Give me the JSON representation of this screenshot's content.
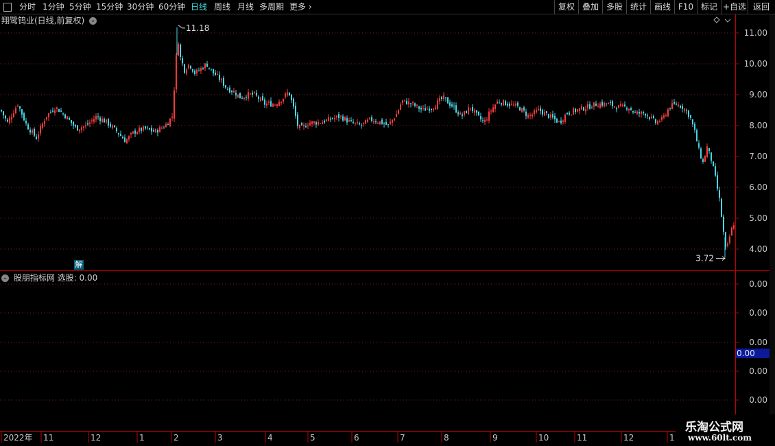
{
  "toolbar": {
    "periods": [
      "分时",
      "1分钟",
      "5分钟",
      "15分钟",
      "30分钟",
      "60分钟",
      "日线",
      "周线",
      "月线",
      "多周期",
      "更多"
    ],
    "active_period": "日线",
    "right_buttons": [
      "复权",
      "叠加",
      "多股",
      "统计",
      "画线",
      "F10",
      "标记",
      "+自选",
      "返回"
    ]
  },
  "stock_title": "翔鹭钨业(日线,前复权)",
  "indicator_title": "股朋指标网 选股: 0.00",
  "jie_label": "解",
  "annotations": {
    "high": "11.18",
    "low": "3.72"
  },
  "chart_data": {
    "type": "candlestick",
    "title": "翔鹭钨业(日线,前复权)",
    "price_ticks": [
      "11.00",
      "10.00",
      "9.00",
      "8.00",
      "7.00",
      "6.00",
      "5.00",
      "4.00"
    ],
    "price_range": [
      3.5,
      11.5
    ],
    "high": 11.18,
    "low": 3.72,
    "indicator": {
      "name": "选股",
      "value": 0.0,
      "ticks": [
        "0.00",
        "0.00",
        "0.00",
        "0.00",
        "0.00"
      ],
      "current_label": "0.00"
    },
    "x_labels": [
      "2022年",
      "11",
      "12",
      "1",
      "2",
      "3",
      "4",
      "5",
      "6",
      "7",
      "8",
      "9",
      "10",
      "11",
      "12",
      "1"
    ],
    "close_path": [
      [
        0,
        8.5
      ],
      [
        10,
        8.1
      ],
      [
        25,
        8.7
      ],
      [
        38,
        8.0
      ],
      [
        52,
        7.6
      ],
      [
        66,
        8.3
      ],
      [
        80,
        8.6
      ],
      [
        95,
        8.3
      ],
      [
        110,
        7.9
      ],
      [
        125,
        8.0
      ],
      [
        140,
        8.3
      ],
      [
        155,
        8.1
      ],
      [
        170,
        7.8
      ],
      [
        182,
        7.5
      ],
      [
        195,
        7.8
      ],
      [
        210,
        7.9
      ],
      [
        225,
        7.8
      ],
      [
        240,
        8.0
      ],
      [
        250,
        8.3
      ],
      [
        253,
        9.2
      ],
      [
        258,
        10.9
      ],
      [
        262,
        10.2
      ],
      [
        268,
        9.8
      ],
      [
        275,
        10.0
      ],
      [
        283,
        9.7
      ],
      [
        290,
        9.8
      ],
      [
        300,
        10.0
      ],
      [
        310,
        9.7
      ],
      [
        320,
        9.5
      ],
      [
        330,
        9.2
      ],
      [
        340,
        9.1
      ],
      [
        350,
        8.9
      ],
      [
        360,
        9.0
      ],
      [
        370,
        9.0
      ],
      [
        385,
        8.7
      ],
      [
        400,
        8.7
      ],
      [
        412,
        8.9
      ],
      [
        420,
        9.1
      ],
      [
        428,
        8.5
      ],
      [
        433,
        8.0
      ],
      [
        438,
        7.9
      ],
      [
        450,
        8.1
      ],
      [
        465,
        8.1
      ],
      [
        480,
        8.2
      ],
      [
        495,
        8.3
      ],
      [
        510,
        8.1
      ],
      [
        525,
        8.0
      ],
      [
        540,
        8.2
      ],
      [
        555,
        8.1
      ],
      [
        565,
        8.0
      ],
      [
        578,
        8.4
      ],
      [
        585,
        8.8
      ],
      [
        600,
        8.7
      ],
      [
        615,
        8.5
      ],
      [
        630,
        8.6
      ],
      [
        645,
        8.9
      ],
      [
        660,
        8.6
      ],
      [
        672,
        8.3
      ],
      [
        685,
        8.6
      ],
      [
        695,
        8.3
      ],
      [
        705,
        8.1
      ],
      [
        715,
        8.5
      ],
      [
        725,
        8.8
      ],
      [
        740,
        8.7
      ],
      [
        755,
        8.6
      ],
      [
        770,
        8.3
      ],
      [
        785,
        8.5
      ],
      [
        800,
        8.3
      ],
      [
        815,
        8.1
      ],
      [
        825,
        8.4
      ],
      [
        840,
        8.5
      ],
      [
        855,
        8.6
      ],
      [
        870,
        8.7
      ],
      [
        885,
        8.7
      ],
      [
        900,
        8.6
      ],
      [
        915,
        8.6
      ],
      [
        925,
        8.4
      ],
      [
        940,
        8.4
      ],
      [
        955,
        8.1
      ],
      [
        965,
        8.2
      ],
      [
        975,
        8.6
      ],
      [
        985,
        8.7
      ],
      [
        995,
        8.6
      ],
      [
        1005,
        8.3
      ],
      [
        1012,
        7.8
      ],
      [
        1018,
        7.2
      ],
      [
        1024,
        6.8
      ],
      [
        1030,
        7.3
      ],
      [
        1036,
        6.9
      ],
      [
        1042,
        6.3
      ],
      [
        1048,
        5.6
      ],
      [
        1053,
        4.7
      ],
      [
        1057,
        4.0
      ],
      [
        1060,
        4.1
      ],
      [
        1064,
        4.5
      ],
      [
        1068,
        4.8
      ],
      [
        1071,
        4.9
      ]
    ]
  },
  "logo": {
    "line1": "乐淘公式网",
    "line2": "www.60lt.com"
  },
  "colors": {
    "up": "#ff3b3b",
    "down": "#47d6e6",
    "grid": "#7a1e1e",
    "axis": "#c00000",
    "label_bg": "#0a1a9a"
  }
}
